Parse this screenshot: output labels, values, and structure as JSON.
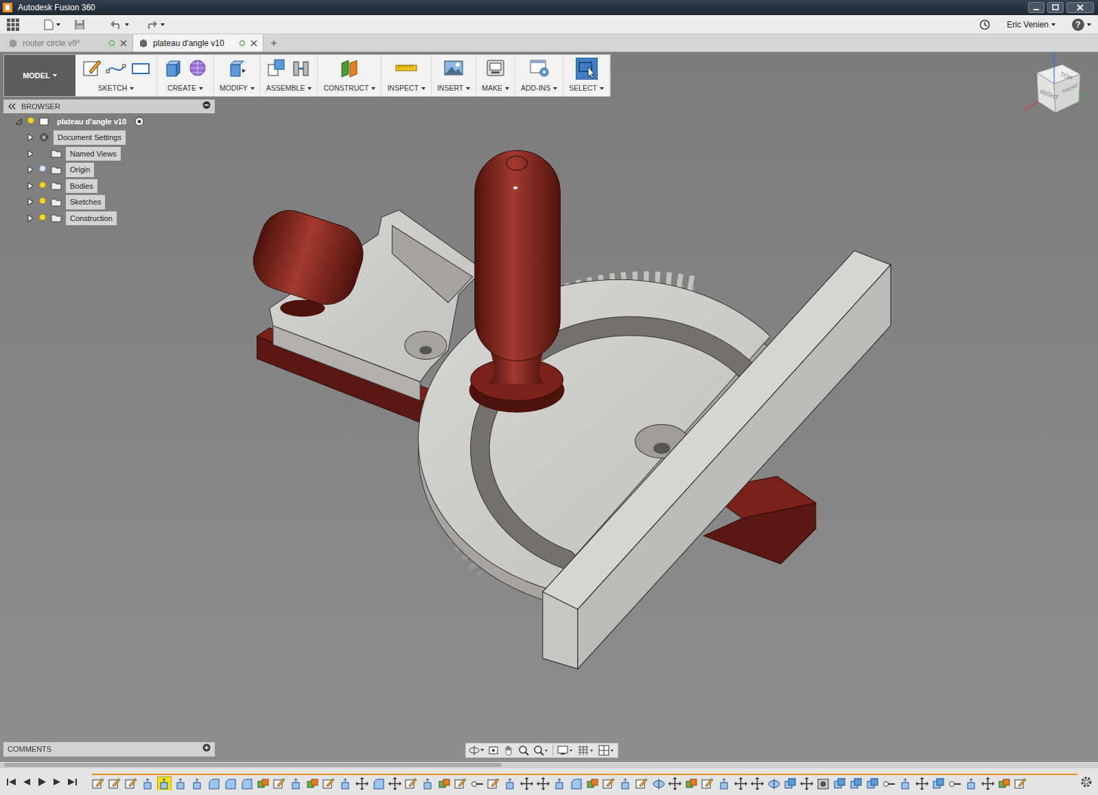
{
  "window": {
    "title": "Autodesk Fusion 360"
  },
  "quickbar": {
    "user": "Eric Venien",
    "help": "?"
  },
  "tabs": [
    {
      "label": "router circle v9*",
      "selected": false
    },
    {
      "label": "plateau d'angle v10",
      "selected": true
    }
  ],
  "new_tab": "+",
  "ribbon": {
    "workspace": "MODEL",
    "groups": [
      {
        "label": "SKETCH",
        "selected": false
      },
      {
        "label": "CREATE",
        "selected": false
      },
      {
        "label": "MODIFY",
        "selected": false
      },
      {
        "label": "ASSEMBLE",
        "selected": false
      },
      {
        "label": "CONSTRUCT",
        "selected": false
      },
      {
        "label": "INSPECT",
        "selected": false
      },
      {
        "label": "INSERT",
        "selected": false
      },
      {
        "label": "MAKE",
        "selected": false
      },
      {
        "label": "ADD-INS",
        "selected": false
      },
      {
        "label": "SELECT",
        "selected": true
      }
    ]
  },
  "browser": {
    "title": "BROWSER",
    "root": {
      "label": "plateau d'angle v10",
      "expanded": true,
      "visible": true
    },
    "items": [
      {
        "label": "Document Settings",
        "kind": "settings",
        "expanded": false
      },
      {
        "label": "Named Views",
        "kind": "folder",
        "expanded": false
      },
      {
        "label": "Origin",
        "kind": "toggle-folder",
        "expanded": false,
        "visible": false
      },
      {
        "label": "Bodies",
        "kind": "toggle-folder",
        "expanded": false,
        "visible": true
      },
      {
        "label": "Sketches",
        "kind": "toggle-folder",
        "expanded": false,
        "visible": true
      },
      {
        "label": "Construction",
        "kind": "toggle-folder",
        "expanded": false,
        "visible": true
      }
    ]
  },
  "viewcube": {
    "faces": [
      "TOP",
      "RIGHT",
      "FRONT"
    ],
    "axes": [
      "Z",
      "X",
      "Y"
    ]
  },
  "comments": {
    "title": "COMMENTS"
  },
  "timeline": {
    "features": [
      {
        "kind": "sketch",
        "selected": false
      },
      {
        "kind": "sketch",
        "selected": false
      },
      {
        "kind": "sketch",
        "selected": false
      },
      {
        "kind": "extrude",
        "selected": false
      },
      {
        "kind": "extrude",
        "selected": true
      },
      {
        "kind": "extrude",
        "selected": false
      },
      {
        "kind": "extrude",
        "selected": false
      },
      {
        "kind": "fillet",
        "selected": false
      },
      {
        "kind": "fillet",
        "selected": false
      },
      {
        "kind": "fillet",
        "selected": false
      },
      {
        "kind": "combine",
        "selected": false
      },
      {
        "kind": "sketch",
        "selected": false
      },
      {
        "kind": "extrude",
        "selected": false
      },
      {
        "kind": "combine",
        "selected": false
      },
      {
        "kind": "sketch",
        "selected": false
      },
      {
        "kind": "extrude",
        "selected": false
      },
      {
        "kind": "move",
        "selected": false
      },
      {
        "kind": "fillet",
        "selected": false
      },
      {
        "kind": "move",
        "selected": false
      },
      {
        "kind": "sketch",
        "selected": false
      },
      {
        "kind": "extrude",
        "selected": false
      },
      {
        "kind": "combine",
        "selected": false
      },
      {
        "kind": "sketch",
        "selected": false
      },
      {
        "kind": "joint",
        "selected": false
      },
      {
        "kind": "sketch",
        "selected": false
      },
      {
        "kind": "extrude",
        "selected": false
      },
      {
        "kind": "move",
        "selected": false
      },
      {
        "kind": "move",
        "selected": false
      },
      {
        "kind": "extrude",
        "selected": false
      },
      {
        "kind": "fillet",
        "selected": false
      },
      {
        "kind": "combine",
        "selected": false
      },
      {
        "kind": "sketch",
        "selected": false
      },
      {
        "kind": "extrude",
        "selected": false
      },
      {
        "kind": "sketch",
        "selected": false
      },
      {
        "kind": "revolve",
        "selected": false
      },
      {
        "kind": "move",
        "selected": false
      },
      {
        "kind": "combine",
        "selected": false
      },
      {
        "kind": "sketch",
        "selected": false
      },
      {
        "kind": "extrude",
        "selected": false
      },
      {
        "kind": "move",
        "selected": false
      },
      {
        "kind": "move",
        "selected": false
      },
      {
        "kind": "revolve",
        "selected": false
      },
      {
        "kind": "copy",
        "selected": false
      },
      {
        "kind": "move",
        "selected": false
      },
      {
        "kind": "hole",
        "selected": false
      },
      {
        "kind": "copy",
        "selected": false
      },
      {
        "kind": "copy",
        "selected": false
      },
      {
        "kind": "copy",
        "selected": false
      },
      {
        "kind": "joint",
        "selected": false
      },
      {
        "kind": "extrude",
        "selected": false
      },
      {
        "kind": "move",
        "selected": false
      },
      {
        "kind": "copy",
        "selected": false
      },
      {
        "kind": "joint",
        "selected": false
      },
      {
        "kind": "extrude",
        "selected": false
      },
      {
        "kind": "move",
        "selected": false
      },
      {
        "kind": "combine",
        "selected": false
      },
      {
        "kind": "sketch",
        "selected": false
      }
    ]
  }
}
